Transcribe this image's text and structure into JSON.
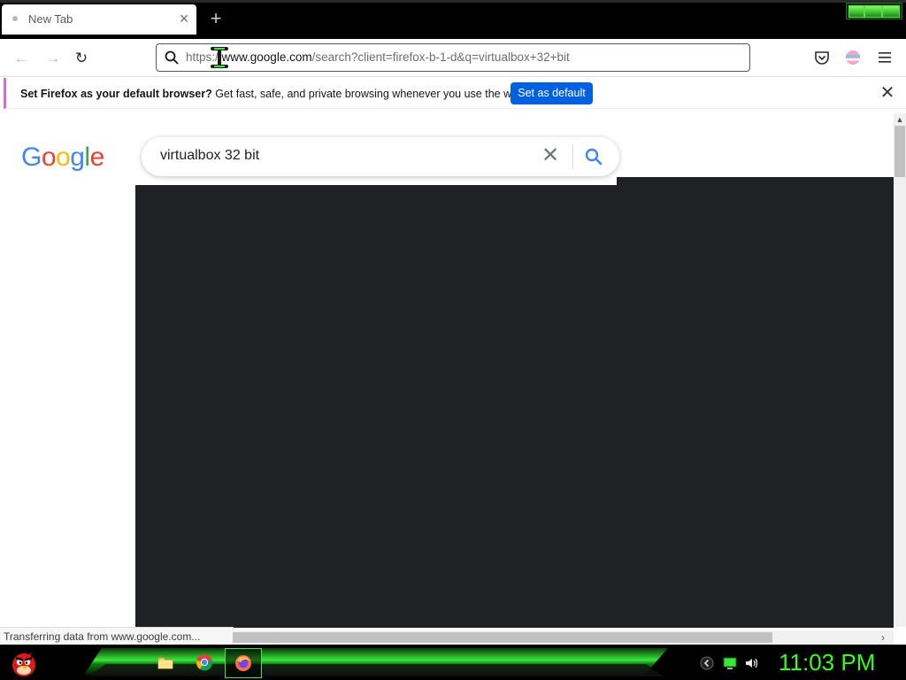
{
  "browser": {
    "tab": {
      "title": "New Tab",
      "close_glyph": "×"
    },
    "newtab_glyph": "+",
    "nav": {
      "back": "←",
      "forward": "→",
      "reload": "↻"
    },
    "url": {
      "scheme": "https://",
      "host": "www.google.com",
      "rest": "/search?client=firefox-b-1-d&q=virtualbox+32+bit"
    },
    "notification": {
      "bold": "Set Firefox as your default browser?",
      "text": " Get fast, safe, and private browsing whenever you use the web.",
      "button": "Set as default",
      "close_glyph": "✕"
    },
    "status": "Transferring data from www.google.com..."
  },
  "google": {
    "logo_letters": [
      {
        "ch": "G",
        "color": "#4285F4"
      },
      {
        "ch": "o",
        "color": "#EA4335"
      },
      {
        "ch": "o",
        "color": "#FBBC05"
      },
      {
        "ch": "g",
        "color": "#4285F4"
      },
      {
        "ch": "l",
        "color": "#34A853"
      },
      {
        "ch": "e",
        "color": "#EA4335"
      }
    ],
    "query": "virtualbox 32 bit",
    "clear_glyph": "✕"
  },
  "taskbar": {
    "clock": "11:03 PM",
    "icons": [
      "angry-bird-start-icon",
      "folder-icon",
      "chrome-icon",
      "firefox-icon"
    ],
    "tray": [
      "tray-arrow-icon",
      "network-monitor-icon",
      "volume-icon"
    ]
  },
  "colors": {
    "accent_blue": "#0061e0",
    "clock_green": "#39ff14",
    "notif_stripe": "#d46bd6"
  }
}
